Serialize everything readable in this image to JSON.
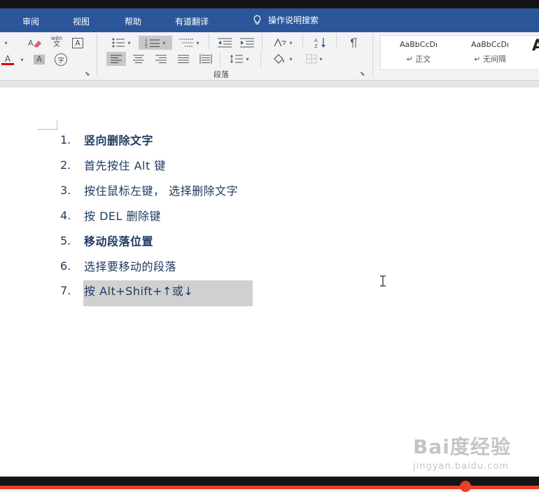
{
  "tabs": [
    "审阅",
    "视图",
    "帮助",
    "有道翻译"
  ],
  "tell_me": "操作说明搜索",
  "ribbon": {
    "paragraph_group_label": "段落",
    "phonetic_top": "wén",
    "phonetic_bottom": "文",
    "boxed_char": "A",
    "font_color_letter": "A",
    "shading_letter": "A",
    "enclosed_char": "字"
  },
  "styles": [
    {
      "preview": "AaBbCcDı",
      "name": "↵ 正文"
    },
    {
      "preview": "AaBbCcDı",
      "name": "↵ 无间隔"
    }
  ],
  "styles_next_preview": "A",
  "document": {
    "items": [
      {
        "num": "1.",
        "text": "竖向删除文字"
      },
      {
        "num": "2.",
        "text": "首先按住 Alt 键"
      },
      {
        "num": "3.",
        "text": "按住鼠标左键， 选择删除文字"
      },
      {
        "num": "4.",
        "text": "按 DEL 删除键"
      },
      {
        "num": "5.",
        "text": "移动段落位置"
      },
      {
        "num": "6.",
        "text": "选择要移动的段落"
      },
      {
        "num": "7.",
        "text": "按 Alt+Shift+↑或↓"
      }
    ]
  },
  "watermark": {
    "logo": "Bai度经验",
    "url": "jingyan.baidu.com"
  },
  "colors": {
    "tabbar": "#2b579a",
    "text": "#1e3a5f",
    "progress": "#e8402a"
  }
}
